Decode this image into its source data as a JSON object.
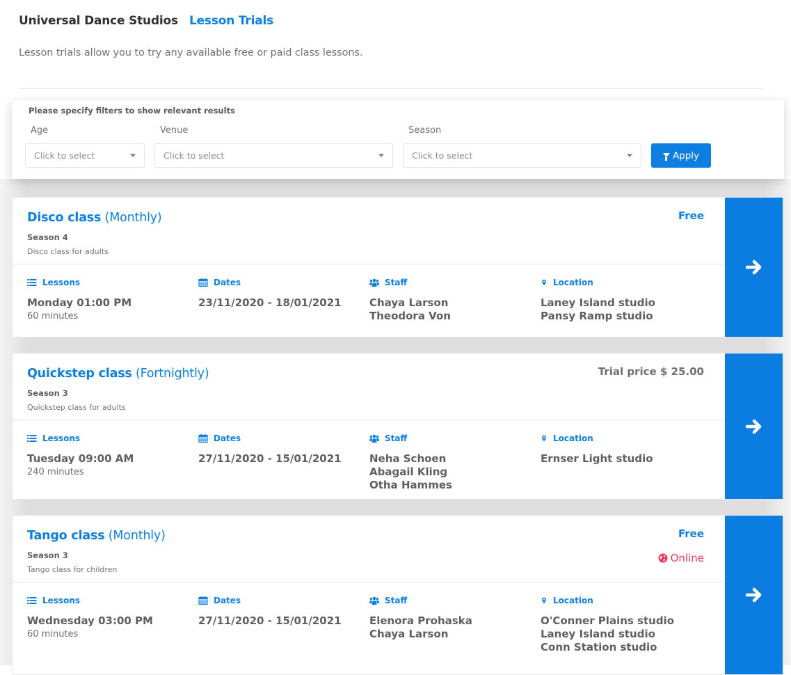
{
  "header": {
    "brand": "Universal Dance Studios",
    "title": "Lesson Trials",
    "intro": "Lesson trials allow you to try any available free or paid class lessons."
  },
  "filters": {
    "hint": "Please specify filters to show relevant results",
    "age": {
      "label": "Age",
      "placeholder": "Click to select"
    },
    "venue": {
      "label": "Venue",
      "placeholder": "Click to select"
    },
    "season": {
      "label": "Season",
      "placeholder": "Click to select"
    },
    "apply_label": "Apply",
    "apply_icon": "filter-icon"
  },
  "column_labels": {
    "lessons": "Lessons",
    "dates": "Dates",
    "staff": "Staff",
    "location": "Location"
  },
  "colors": {
    "accent": "#0d7fe1",
    "online": "#ec3a5c",
    "text": "#5c5f64"
  },
  "classes": [
    {
      "name": "Disco class",
      "frequency": "(Monthly)",
      "season": "Season 4",
      "description": "Disco class for adults",
      "price": "Free",
      "online": null,
      "lesson_time": "Monday 01:00 PM",
      "duration": "60 minutes",
      "dates": "23/11/2020 - 18/01/2021",
      "staff": [
        "Chaya Larson",
        "Theodora Von"
      ],
      "locations": [
        "Laney Island studio",
        "Pansy Ramp studio"
      ]
    },
    {
      "name": "Quickstep class",
      "frequency": "(Fortnightly)",
      "season": "Season 3",
      "description": "Quickstep class for adults",
      "price": "Trial price $ 25.00",
      "online": null,
      "lesson_time": "Tuesday 09:00 AM",
      "duration": "240 minutes",
      "dates": "27/11/2020 - 15/01/2021",
      "staff": [
        "Neha Schoen",
        "Abagail Kling",
        "Otha Hammes"
      ],
      "locations": [
        "Ernser Light studio"
      ]
    },
    {
      "name": "Tango class",
      "frequency": "(Monthly)",
      "season": "Season 3",
      "description": "Tango class for children",
      "price": "Free",
      "online": "Online",
      "lesson_time": "Wednesday 03:00 PM",
      "duration": "60 minutes",
      "dates": "27/11/2020 - 15/01/2021",
      "staff": [
        "Elenora Prohaska",
        "Chaya Larson"
      ],
      "locations": [
        "O'Conner Plains studio",
        "Laney Island studio",
        "Conn Station studio"
      ]
    }
  ]
}
